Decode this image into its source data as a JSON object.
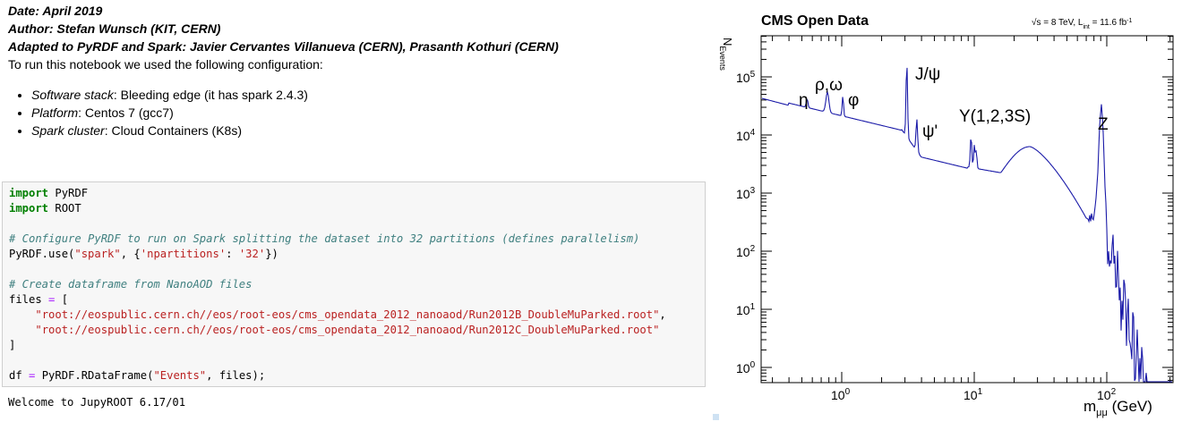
{
  "markdown": {
    "date": "Date: April 2019",
    "author": "Author: Stefan Wunsch (KIT, CERN)",
    "adapted": "Adapted to PyRDF and Spark: Javier Cervantes Villanueva (CERN), Prasanth Kothuri (CERN)",
    "config_intro": "To run this notebook we used the following configuration:",
    "bullets": [
      {
        "key": "Software stack",
        "value": ": Bleeding edge (it has spark 2.4.3)"
      },
      {
        "key": "Platform",
        "value": ": Centos 7 (gcc7)"
      },
      {
        "key": "Spark cluster",
        "value": ": Cloud Containers (K8s)"
      }
    ]
  },
  "code": {
    "import_kw": "import",
    "mod1": " PyRDF",
    "mod2": " ROOT",
    "comment1": "# Configure PyRDF to run on Spark splitting the dataset into 32 partitions (defines parallelism)",
    "use_call_a": "PyRDF.use(",
    "use_arg1": "\"spark\"",
    "use_sep": ", {",
    "use_key": "'npartitions'",
    "use_colon": ": ",
    "use_val": "'32'",
    "use_end": "})",
    "comment2": "# Create dataframe from NanoAOD files",
    "files_var": "files ",
    "eq": "=",
    "bracket_open": " [",
    "file1": "\"root://eospublic.cern.ch//eos/root-eos/cms_opendata_2012_nanoaod/Run2012B_DoubleMuParked.root\"",
    "comma": ",",
    "file2": "\"root://eospublic.cern.ch//eos/root-eos/cms_opendata_2012_nanoaod/Run2012C_DoubleMuParked.root\"",
    "bracket_close": "]",
    "df_var": "df ",
    "df_call": " PyRDF.RDataFrame(",
    "df_arg": "\"Events\"",
    "df_end": ", files);"
  },
  "output": "Welcome to JupyROOT 6.17/01",
  "plot": {
    "title": "CMS Open Data",
    "energy_label": "√s = 8 TeV, L",
    "energy_sub": "int",
    "energy_value": " = 11.6 fb",
    "energy_sup": "-1",
    "ylabel_main": "N",
    "ylabel_sub": "Events",
    "xlabel_main": "m",
    "xlabel_sub": "μμ",
    "xlabel_unit": " (GeV)",
    "x_ticks": [
      {
        "base": "10",
        "exp": "0"
      },
      {
        "base": "10",
        "exp": "1"
      },
      {
        "base": "10",
        "exp": "2"
      }
    ],
    "y_ticks": [
      {
        "base": "10",
        "exp": "0"
      },
      {
        "base": "10",
        "exp": "1"
      },
      {
        "base": "10",
        "exp": "2"
      },
      {
        "base": "10",
        "exp": "3"
      },
      {
        "base": "10",
        "exp": "4"
      },
      {
        "base": "10",
        "exp": "5"
      }
    ],
    "resonances": [
      "η",
      "ρ,ω",
      "φ",
      "J/ψ",
      "ψ'",
      "Y(1,2,3S)",
      "Z"
    ],
    "line_color": "#1a1aa8"
  }
}
